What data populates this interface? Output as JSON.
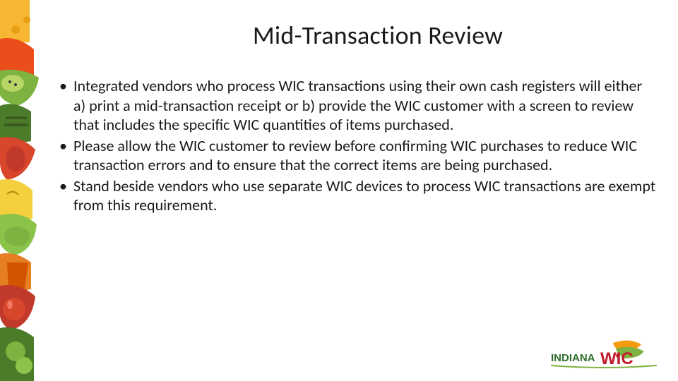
{
  "slide": {
    "title": "Mid-Transaction Review",
    "bullets": [
      "Integrated vendors who process WIC transactions using their own cash registers will either a) print a mid-transaction receipt or b) provide the WIC customer with a screen to review that includes the specific WIC quantities of items purchased.",
      "Please allow the WIC customer to review before confirming WIC purchases to reduce WIC transaction errors and to ensure that the correct items are being purchased.",
      "Stand beside vendors who use separate WIC devices to process WIC transactions are exempt from this requirement."
    ]
  },
  "logo": {
    "indiana": "INDIANA",
    "wic": "WIC"
  },
  "decor": {
    "colors": [
      "#f7b733",
      "#e94e1b",
      "#7fb341",
      "#4a7c2a",
      "#d8462b",
      "#f4d03f",
      "#b8d666",
      "#c0392b",
      "#e67e22",
      "#8bc34a"
    ]
  }
}
